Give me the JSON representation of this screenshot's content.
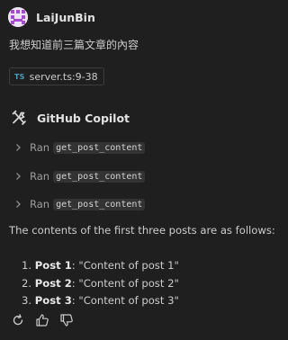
{
  "user": {
    "name": "LaiJunBin",
    "message": "我想知道前三篇文章的內容"
  },
  "reference": {
    "icon": "TS",
    "label": "server.ts:9-38"
  },
  "assistant": {
    "name": "GitHub Copilot",
    "tool_calls": [
      {
        "prefix": "Ran",
        "tool": "get_post_content"
      },
      {
        "prefix": "Ran",
        "tool": "get_post_content"
      },
      {
        "prefix": "Ran",
        "tool": "get_post_content"
      }
    ],
    "intro": "The contents of the first three posts are as follows:",
    "items": [
      {
        "number": "1.",
        "title": "Post 1",
        "text": ": \"Content of post 1\""
      },
      {
        "number": "2.",
        "title": "Post 2",
        "text": ": \"Content of post 2\""
      },
      {
        "number": "3.",
        "title": "Post 3",
        "text": ": \"Content of post 3\""
      }
    ]
  },
  "actions": [
    "retry-icon",
    "thumbs-up-icon",
    "thumbs-down-icon"
  ],
  "colors": {
    "background": "#1f1f1f",
    "ts_blue": "#519aba",
    "code_bg": "#333333"
  }
}
